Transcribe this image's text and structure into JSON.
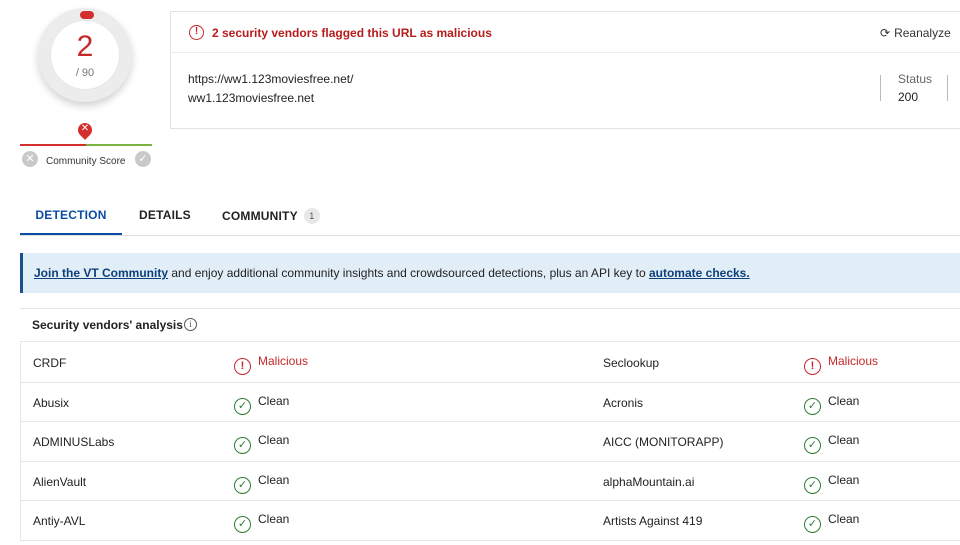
{
  "score": {
    "detections": "2",
    "total": "/ 90"
  },
  "community": {
    "label": "Community Score",
    "down_icon": "x-icon",
    "up_icon": "check-icon"
  },
  "summary": {
    "alert": "2 security vendors flagged this URL as malicious",
    "reanalyze": "Reanalyze",
    "url": "https://ww1.123moviesfree.net/",
    "host": "ww1.123moviesfree.net",
    "status_label": "Status",
    "status_value": "200"
  },
  "tabs": [
    {
      "label": "DETECTION"
    },
    {
      "label": "DETAILS"
    },
    {
      "label": "COMMUNITY",
      "badge": "1"
    }
  ],
  "banner": {
    "link1": "Join the VT Community",
    "middle": " and enjoy additional community insights and crowdsourced detections, plus an API key to ",
    "link2": "automate checks."
  },
  "vendors": {
    "title": "Security vendors' analysis",
    "rows": [
      {
        "a_name": "CRDF",
        "a_result": "Malicious",
        "a_status": "bad",
        "b_name": "Seclookup",
        "b_result": "Malicious",
        "b_status": "bad"
      },
      {
        "a_name": "Abusix",
        "a_result": "Clean",
        "a_status": "ok",
        "b_name": "Acronis",
        "b_result": "Clean",
        "b_status": "ok"
      },
      {
        "a_name": "ADMINUSLabs",
        "a_result": "Clean",
        "a_status": "ok",
        "b_name": "AICC (MONITORAPP)",
        "b_result": "Clean",
        "b_status": "ok"
      },
      {
        "a_name": "AlienVault",
        "a_result": "Clean",
        "a_status": "ok",
        "b_name": "alphaMountain.ai",
        "b_result": "Clean",
        "b_status": "ok"
      },
      {
        "a_name": "Antiy-AVL",
        "a_result": "Clean",
        "a_status": "ok",
        "b_name": "Artists Against 419",
        "b_result": "Clean",
        "b_status": "ok"
      }
    ]
  },
  "colors": {
    "malicious": "#c62828",
    "clean": "#2e7d32",
    "accent": "#0b4da2",
    "banner_bg": "#e1eef8"
  }
}
